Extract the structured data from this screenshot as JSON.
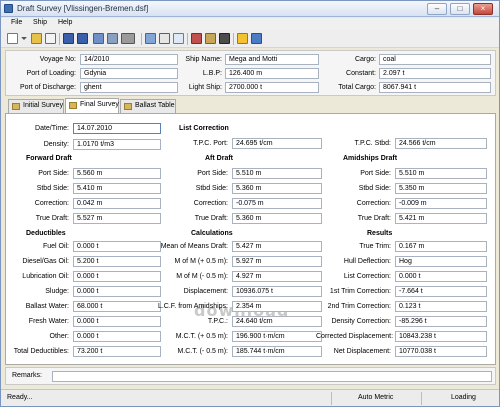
{
  "window": {
    "title": "Draft Survey [Vlissingen-Bremen.dsf]"
  },
  "menu": [
    "File",
    "Ship",
    "Help"
  ],
  "header": {
    "voyage_no": {
      "label": "Voyage No:",
      "value": "14/2010"
    },
    "port_loading": {
      "label": "Port of Loading:",
      "value": "Gdynia"
    },
    "port_discharge": {
      "label": "Port of Discharge:",
      "value": "ghent"
    },
    "ship_name": {
      "label": "Ship Name:",
      "value": "Mega and Motti"
    },
    "lbp": {
      "label": "L.B.P:",
      "value": "126.400 m"
    },
    "light_ship": {
      "label": "Light Ship:",
      "value": "2700.000 t"
    },
    "cargo": {
      "label": "Cargo:",
      "value": "coal"
    },
    "constant": {
      "label": "Constant:",
      "value": "2.097 t"
    },
    "total_cargo": {
      "label": "Total Cargo:",
      "value": "8067.941 t"
    }
  },
  "tabs": [
    "Initial Survey",
    "Final Survey",
    "Ballast Table"
  ],
  "active_tab": "Final Survey",
  "survey": {
    "datetime": {
      "label": "Date/Time:",
      "value": "14.07.2010"
    },
    "density": {
      "label": "Density:",
      "value": "1.0170 t/m3"
    },
    "list_correction": {
      "title": "List Correction",
      "tpc_port": {
        "label": "T.P.C. Port:",
        "value": "24.695 t/cm"
      },
      "tpc_stbd": {
        "label": "T.P.C. Stbd:",
        "value": "24.566 t/cm"
      }
    },
    "forward": {
      "title": "Forward Draft",
      "port_side": {
        "label": "Port Side:",
        "value": "5.560 m"
      },
      "stbd_side": {
        "label": "Stbd Side:",
        "value": "5.410 m"
      },
      "correction": {
        "label": "Correction:",
        "value": "0.042 m"
      },
      "true_draft": {
        "label": "True Draft:",
        "value": "5.527 m"
      }
    },
    "aft": {
      "title": "Aft Draft",
      "port_side": {
        "label": "Port Side:",
        "value": "5.510 m"
      },
      "stbd_side": {
        "label": "Stbd Side:",
        "value": "5.360 m"
      },
      "correction": {
        "label": "Correction:",
        "value": "-0.075 m"
      },
      "true_draft": {
        "label": "True Draft:",
        "value": "5.360 m"
      }
    },
    "amidships": {
      "title": "Amidships Draft",
      "port_side": {
        "label": "Port Side:",
        "value": "5.510 m"
      },
      "stbd_side": {
        "label": "Stbd Side:",
        "value": "5.350 m"
      },
      "correction": {
        "label": "Correction:",
        "value": "-0.009 m"
      },
      "true_draft": {
        "label": "True Draft:",
        "value": "5.421 m"
      }
    },
    "deductibles": {
      "title": "Deductibles",
      "fuel_oil": {
        "label": "Fuel Oil:",
        "value": "0.000 t"
      },
      "diesel_gas_oil": {
        "label": "Diesel/Gas Oil:",
        "value": "5.200 t"
      },
      "lubrication_oil": {
        "label": "Lubrication Oil:",
        "value": "0.000 t"
      },
      "sludge": {
        "label": "Sludge:",
        "value": "0.000 t"
      },
      "ballast_water": {
        "label": "Ballast Water:",
        "value": "68.000 t"
      },
      "fresh_water": {
        "label": "Fresh Water:",
        "value": "0.000 t"
      },
      "other": {
        "label": "Other:",
        "value": "0.000 t"
      },
      "total": {
        "label": "Total Deductibles:",
        "value": "73.200 t"
      }
    },
    "calculations": {
      "title": "Calculations",
      "mean_of_means": {
        "label": "Mean of Means Draft:",
        "value": "5.427 m"
      },
      "mom_plus": {
        "label": "M of M (+ 0.5 m):",
        "value": "5.927 m"
      },
      "mom_minus": {
        "label": "M of M (- 0.5 m):",
        "value": "4.927 m"
      },
      "displacement": {
        "label": "Displacement:",
        "value": "10936.075 t"
      },
      "lcf": {
        "label": "L.C.F. from Amidships:",
        "value": "2.354 m"
      },
      "tpc": {
        "label": "T.P.C.:",
        "value": "24.640 t/cm"
      },
      "mct_plus": {
        "label": "M.C.T. (+ 0.5 m):",
        "value": "196.900 t·m/cm"
      },
      "mct_minus": {
        "label": "M.C.T. (- 0.5 m):",
        "value": "185.744 t·m/cm"
      }
    },
    "results": {
      "title": "Results",
      "true_trim": {
        "label": "True Trim:",
        "value": "0.167 m"
      },
      "hull_deflection": {
        "label": "Hull Deflection:",
        "value": "Hog"
      },
      "list_correction": {
        "label": "List Correction:",
        "value": "0.000 t"
      },
      "trim_1st": {
        "label": "1st Trim Correction:",
        "value": "-7.664 t"
      },
      "trim_2nd": {
        "label": "2nd Trim Correction:",
        "value": "0.123 t"
      },
      "density_correction": {
        "label": "Density Correction:",
        "value": "-85.296 t"
      },
      "corrected_displacement": {
        "label": "Corrected Displacement:",
        "value": "10843.238 t"
      },
      "net_displacement": {
        "label": "Net Displacement:",
        "value": "10770.038 t"
      }
    }
  },
  "remarks": {
    "label": "Remarks:",
    "value": ""
  },
  "status": {
    "left": "Ready...",
    "middle": "Auto Metric",
    "right": "Loading"
  },
  "watermark": "download"
}
